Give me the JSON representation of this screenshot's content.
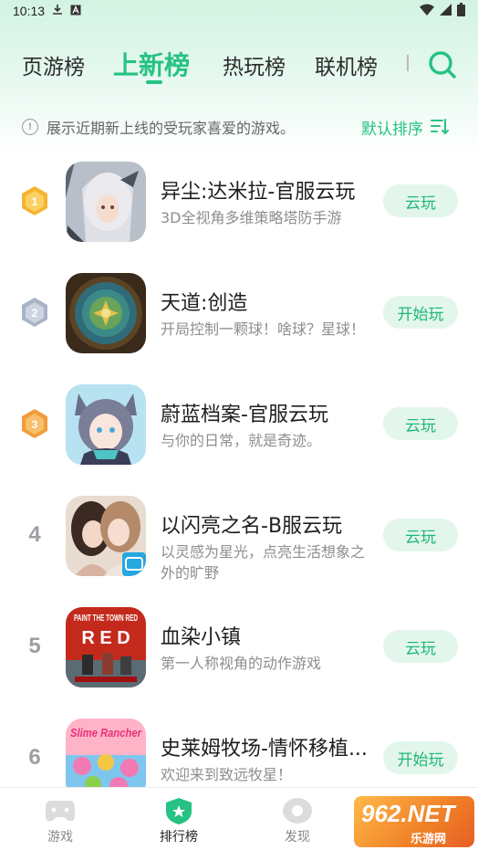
{
  "status_bar": {
    "time": "10:13"
  },
  "tabs": [
    "页游榜",
    "上新榜",
    "热玩榜",
    "联机榜"
  ],
  "active_tab": 1,
  "notice": {
    "text": "展示近期新上线的受玩家喜爱的游戏。",
    "sort_label": "默认排序"
  },
  "games": [
    {
      "rank": "1",
      "title": "异尘:达米拉-官服云玩",
      "desc": "3D全视角多维策略塔防手游",
      "button": "云玩"
    },
    {
      "rank": "2",
      "title": "天道:创造",
      "desc": "开局控制一颗球！啥球？星球！",
      "button": "开始玩"
    },
    {
      "rank": "3",
      "title": "蔚蓝档案-官服云玩",
      "desc": "与你的日常，就是奇迹。",
      "button": "云玩"
    },
    {
      "rank": "4",
      "title": "以闪亮之名-B服云玩",
      "desc": "以灵感为星光，点亮生活想象之外的旷野",
      "button": "云玩"
    },
    {
      "rank": "5",
      "title": "血染小镇",
      "desc": "第一人称视角的动作游戏",
      "button": "云玩"
    },
    {
      "rank": "6",
      "title": "史莱姆牧场-情怀移植...",
      "desc": "欢迎来到致远牧星！",
      "button": "开始玩"
    }
  ],
  "icon_art": {
    "paint_the_town": "PAINT THE TOWN RED",
    "slime_rancher": "Slime Rancher"
  },
  "bottom_nav": [
    {
      "label": "游戏",
      "icon": "gamepad-icon"
    },
    {
      "label": "排行榜",
      "icon": "leaderboard-shield-icon"
    },
    {
      "label": "发现",
      "icon": "discover-icon"
    }
  ],
  "watermark": {
    "main": "962.NET",
    "sub": "乐游网"
  },
  "colors": {
    "accent": "#26c283",
    "button_bg": "#e3f6ec",
    "gold": "#f5b431",
    "silver": "#a9b3c7",
    "bronze": "#f29b3a"
  }
}
